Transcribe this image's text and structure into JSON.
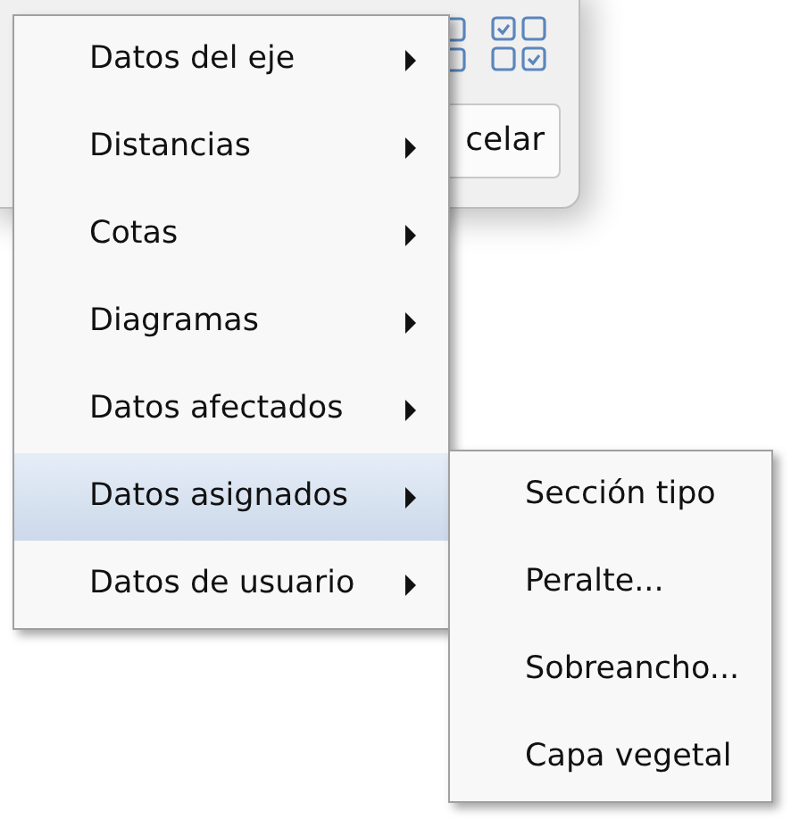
{
  "dialog": {
    "button": "celar"
  },
  "menu": {
    "items": [
      {
        "label": "Datos del eje",
        "selected": false
      },
      {
        "label": "Distancias",
        "selected": false
      },
      {
        "label": "Cotas",
        "selected": false
      },
      {
        "label": "Diagramas",
        "selected": false
      },
      {
        "label": "Datos afectados",
        "selected": false
      },
      {
        "label": "Datos asignados",
        "selected": true
      },
      {
        "label": "Datos de usuario",
        "selected": false
      }
    ]
  },
  "submenu": {
    "items": [
      {
        "label": "Sección tipo"
      },
      {
        "label": "Peralte..."
      },
      {
        "label": "Sobreancho..."
      },
      {
        "label": "Capa vegetal"
      }
    ]
  }
}
